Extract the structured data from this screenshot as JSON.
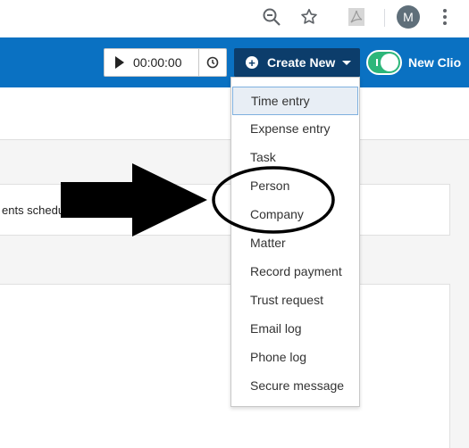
{
  "browser": {
    "icons": [
      "zoom-out-icon",
      "star-icon",
      "pdf-extension-icon",
      "more-vert-icon"
    ],
    "avatar_letter": "M"
  },
  "header": {
    "timer_value": "00:00:00",
    "create_new_label": "Create New",
    "toggle_on": true,
    "new_clio_label": "New Clio",
    "accent": "#0a71c2",
    "create_bg": "#0c3d6b",
    "toggle_color": "#2db67a"
  },
  "content": {
    "card_text": "ents schedu"
  },
  "menu": {
    "items": [
      {
        "label": "Time entry"
      },
      {
        "label": "Expense entry"
      },
      {
        "label": "Task"
      },
      {
        "label": "Person"
      },
      {
        "label": "Company"
      },
      {
        "label": "Matter"
      },
      {
        "label": "Record payment"
      },
      {
        "label": "Trust request"
      },
      {
        "label": "Email log"
      },
      {
        "label": "Phone log"
      },
      {
        "label": "Secure message"
      }
    ],
    "highlighted": "Time entry"
  },
  "annotation": {
    "arrow_color": "#000000",
    "circled_items": [
      "Person",
      "Company"
    ]
  }
}
